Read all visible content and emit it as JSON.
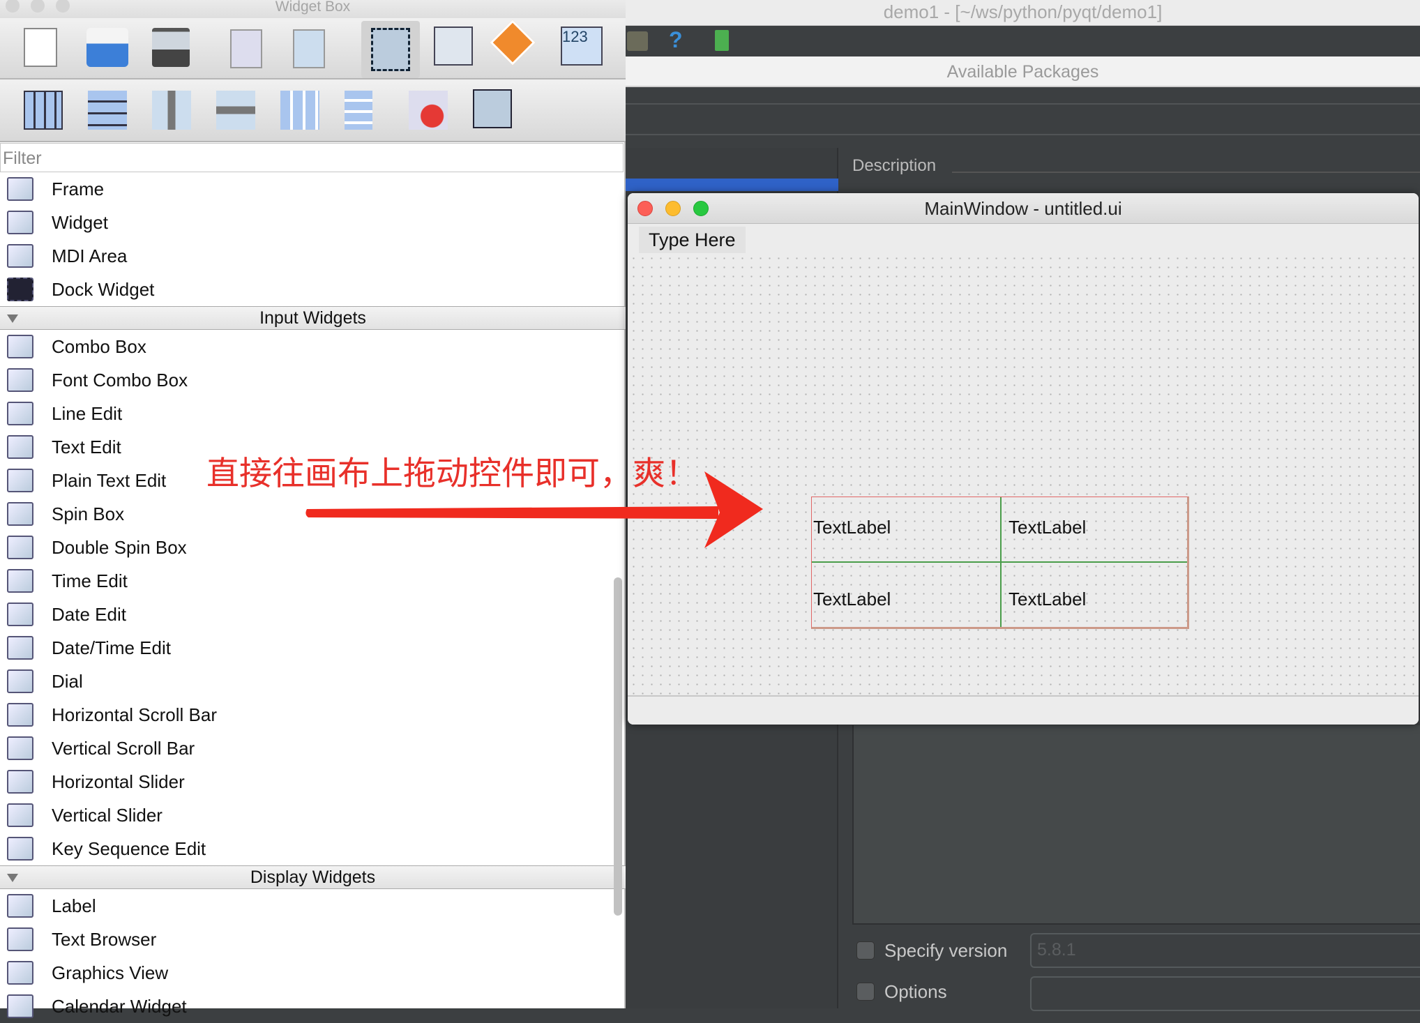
{
  "ide": {
    "title": "demo1 - [~/ws/python/pyqt/demo1]",
    "packages_header": "Available Packages",
    "description_label": "Description",
    "specify_version_label": "Specify version",
    "version_value": "5.8.1",
    "options_label": "Options",
    "options_value": ""
  },
  "widget_box": {
    "title": "Widget Box",
    "toolbar_row1": [
      "new-file",
      "print",
      "save",
      "copy",
      "paste",
      "edit-widgets",
      "edit-signals-slots",
      "edit-buddies",
      "edit-tab-order"
    ],
    "toolbar_row2": [
      "layout-horizontal",
      "layout-vertical",
      "layout-h-splitter",
      "layout-v-splitter",
      "layout-grid",
      "layout-form",
      "break-layout",
      "adjust-size"
    ],
    "filter_placeholder": "Filter",
    "containers_tail": [
      "Frame",
      "Widget",
      "MDI Area",
      "Dock Widget"
    ],
    "input_header": "Input Widgets",
    "input_items": [
      "Combo Box",
      "Font Combo Box",
      "Line Edit",
      "Text Edit",
      "Plain Text Edit",
      "Spin Box",
      "Double Spin Box",
      "Time Edit",
      "Date Edit",
      "Date/Time Edit",
      "Dial",
      "Horizontal Scroll Bar",
      "Vertical Scroll Bar",
      "Horizontal Slider",
      "Vertical Slider",
      "Key Sequence Edit"
    ],
    "display_header": "Display Widgets",
    "display_items": [
      "Label",
      "Text Browser",
      "Graphics View",
      "Calendar Widget"
    ]
  },
  "main_window": {
    "title": "MainWindow - untitled.ui",
    "menu_placeholder": "Type Here",
    "labels": [
      "TextLabel",
      "TextLabel",
      "TextLabel",
      "TextLabel"
    ]
  },
  "annotation": {
    "text": "直接往画布上拖动控件即可，爽！",
    "color": "#e8302a"
  }
}
